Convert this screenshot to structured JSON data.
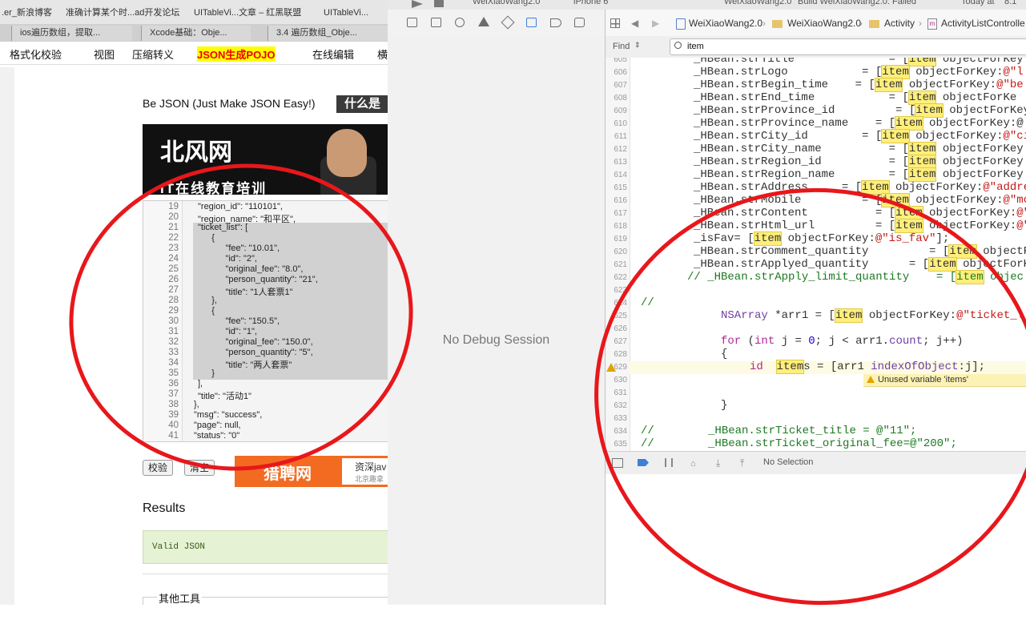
{
  "browser": {
    "tabs": [
      ".er_新浪博客",
      "准确计算某个时...ad开发论坛",
      "UITableVi...文章 – 红黑联盟",
      "UITableVi..."
    ],
    "pinned_tabs": [
      "ios遍历数组，提取...",
      "Xcode基础：Obje...",
      "3.4 遍历数组_Obje..."
    ],
    "menu": [
      "格式化校验",
      "视图",
      "压缩转义",
      "JSON生成POJO",
      "在线编辑",
      "横"
    ],
    "site_title": "Be JSON (Just Make JSON Easy!)",
    "what_is": "什么是",
    "banner": {
      "logo": "北风网",
      "subtitle": "IT在线教育培训"
    },
    "editor": {
      "line_numbers": [
        "19",
        "20",
        "21",
        "22",
        "23",
        "24",
        "25",
        "26",
        "27",
        "28",
        "29",
        "30",
        "31",
        "32",
        "33",
        "34",
        "35",
        "36",
        "37",
        "38",
        "39",
        "40",
        "41"
      ],
      "lines": [
        "\"region_id\": \"110101\",",
        "\"region_name\": \"和平区\",",
        "\"ticket_list\": [",
        "    {",
        "        \"fee\": \"10.01\",",
        "        \"id\": \"2\",",
        "        \"original_fee\": \"8.0\",",
        "        \"person_quantity\": \"21\",",
        "        \"title\": \"1人套票1\"",
        "    },",
        "    {",
        "        \"fee\": \"150.5\",",
        "        \"id\": \"1\",",
        "        \"original_fee\": \"150.0\",",
        "        \"person_quantity\": \"5\",",
        "        \"title\": \"两人套票\"",
        "    }",
        "],",
        "\"title\": \"活动1\"",
        "},",
        "\"msg\": \"success\",",
        "\"page\": null,",
        "\"status\": \"0\""
      ]
    },
    "buttons": {
      "validate": "校验",
      "clear": "清空"
    },
    "ad": {
      "title": "猎聘网",
      "line1": "资深jav",
      "line2": "北京趣拿"
    },
    "results_heading": "Results",
    "result_text": "Valid JSON",
    "other_tools": "其他工具"
  },
  "xcode": {
    "window_strip": [
      "WeiXiaoWang2.0",
      "iPhone 6",
      "WeiXiaoWang2.0",
      "Build WeiXiaoWang2.0: Failed",
      "Today at",
      "8:1"
    ],
    "debug_message": "No Debug Session",
    "breadcrumb": [
      "WeiXiaoWang2.0",
      "WeiXiaoWang2.0",
      "Activity",
      "ActivityListControlle"
    ],
    "find": {
      "label": "Find",
      "query": "item"
    },
    "code_line_numbers": [
      "605",
      "606",
      "607",
      "608",
      "609",
      "610",
      "611",
      "612",
      "613",
      "614",
      "615",
      "616",
      "617",
      "618",
      "619",
      "620",
      "621",
      "622",
      "623",
      "624",
      "625",
      "626",
      "627",
      "628",
      "629",
      "630",
      "631",
      "632",
      "633",
      "634",
      "635"
    ],
    "warning": "Unused variable 'items'",
    "status": "No Selection"
  }
}
